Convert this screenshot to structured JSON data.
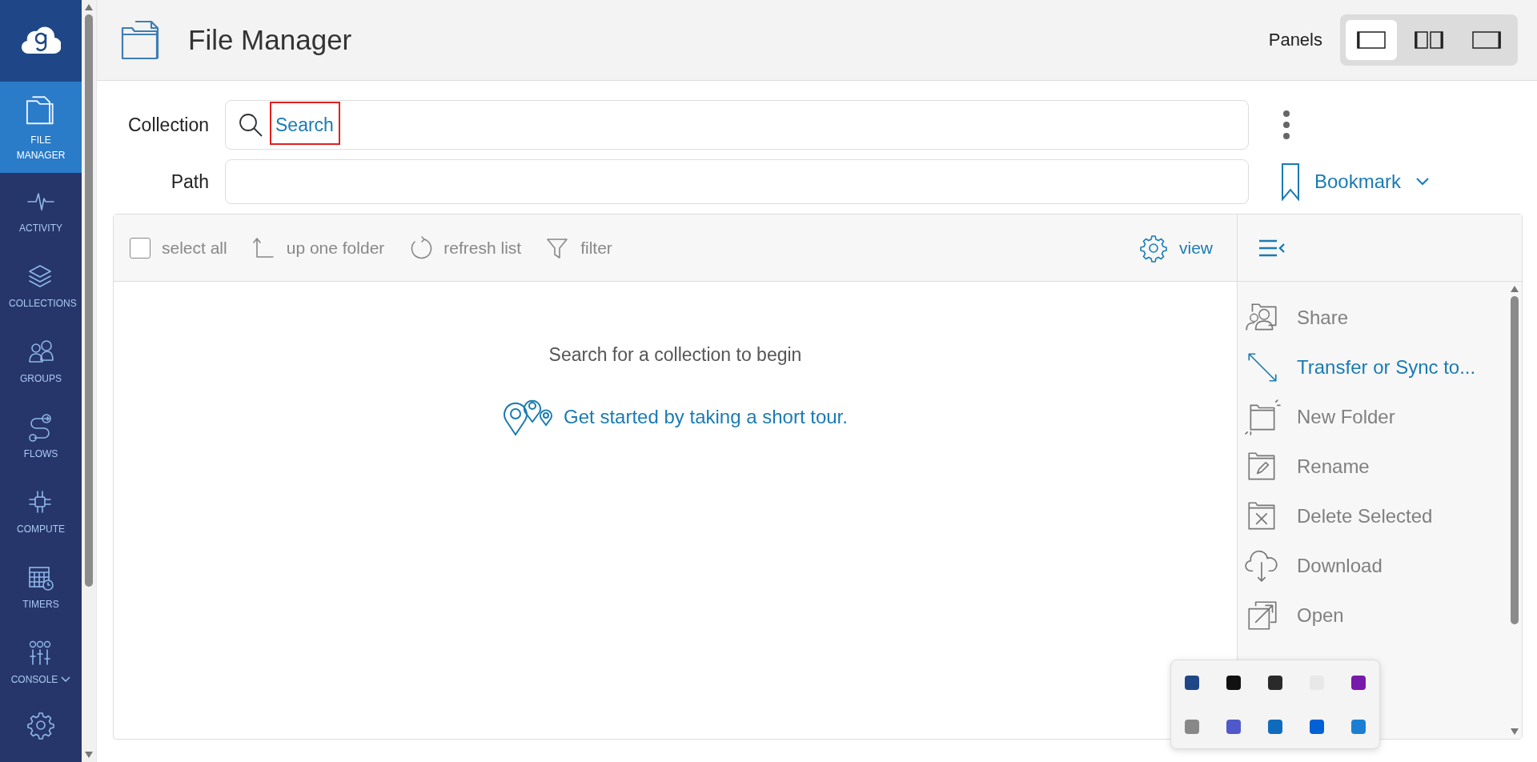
{
  "sidebar": {
    "items": [
      {
        "label": "FILE MANAGER",
        "selected": true,
        "kind": "link"
      },
      {
        "label": "ACTIVITY",
        "selected": false,
        "kind": "link"
      },
      {
        "label": "COLLECTIONS",
        "selected": false,
        "kind": "link"
      },
      {
        "label": "GROUPS",
        "selected": false,
        "kind": "link"
      },
      {
        "label": "FLOWS",
        "selected": false,
        "kind": "link"
      },
      {
        "label": "COMPUTE",
        "selected": false,
        "kind": "link"
      },
      {
        "label": "TIMERS",
        "selected": false,
        "kind": "link"
      },
      {
        "label": "CONSOLE",
        "selected": false,
        "kind": "menu"
      }
    ]
  },
  "header": {
    "title": "File Manager",
    "panels_label": "Panels",
    "panel_options": [
      {
        "selected": true
      },
      {
        "selected": false
      },
      {
        "selected": false
      }
    ]
  },
  "collection": {
    "label": "Collection",
    "placeholder": "Search",
    "highlighted": true
  },
  "path": {
    "label": "Path"
  },
  "bookmark": {
    "label": "Bookmark"
  },
  "toolbar": {
    "select_all": {
      "label": "select all",
      "checked": false
    },
    "actions": [
      {
        "label": "up one folder",
        "disabled": true
      },
      {
        "label": "refresh list",
        "disabled": true
      },
      {
        "label": "filter",
        "disabled": true
      }
    ],
    "view": {
      "label": "view"
    }
  },
  "empty_state": {
    "message": "Search for a collection to begin",
    "tour_link": "Get started by taking a short tour."
  },
  "actions_panel": {
    "items": [
      {
        "label": "Share",
        "disabled": true
      },
      {
        "label": "Transfer or Sync to...",
        "disabled": false
      },
      {
        "label": "New Folder",
        "disabled": true
      },
      {
        "label": "Rename",
        "disabled": true
      },
      {
        "label": "Delete Selected",
        "disabled": true
      },
      {
        "label": "Download",
        "disabled": true
      },
      {
        "label": "Open",
        "disabled": true
      }
    ]
  }
}
